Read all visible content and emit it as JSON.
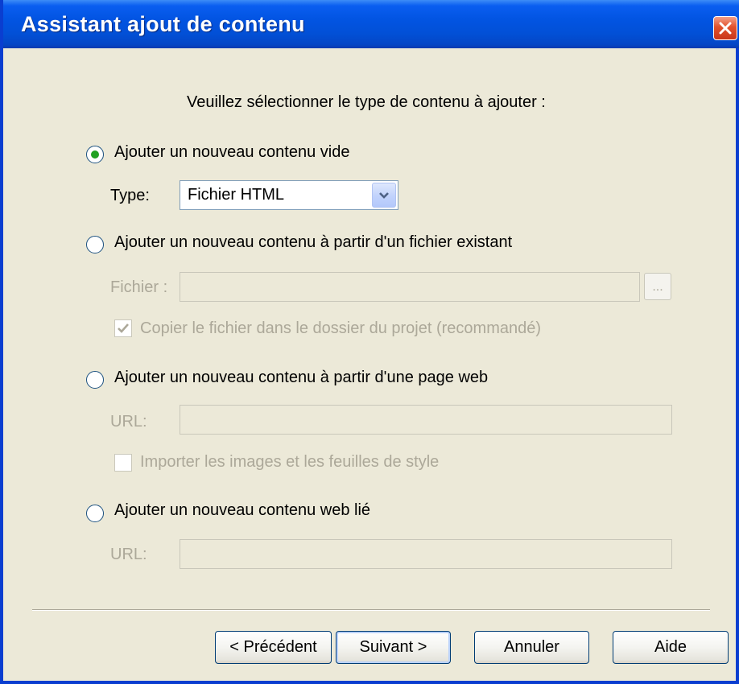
{
  "window": {
    "title": "Assistant ajout de contenu",
    "close_label": "close"
  },
  "instruction": "Veuillez sélectionner le type de contenu à ajouter :",
  "options": {
    "empty": {
      "label": "Ajouter un nouveau contenu vide",
      "selected": true,
      "type_label": "Type:",
      "type_value": "Fichier HTML"
    },
    "from_file": {
      "label": "Ajouter un nouveau contenu à partir d'un fichier existant",
      "selected": false,
      "file_label": "Fichier :",
      "file_value": "",
      "browse_label": "...",
      "copy_label": "Copier le fichier dans le dossier du projet (recommandé)",
      "copy_checked": true
    },
    "from_web": {
      "label": "Ajouter un nouveau contenu à partir d'une page web",
      "selected": false,
      "url_label": "URL:",
      "url_value": "",
      "import_label": "Importer les images et les feuilles de style",
      "import_checked": false
    },
    "linked_web": {
      "label": "Ajouter un nouveau contenu web lié",
      "selected": false,
      "url_label": "URL:",
      "url_value": ""
    }
  },
  "buttons": {
    "previous": "< Précédent",
    "next": "Suivant >",
    "cancel": "Annuler",
    "help": "Aide"
  },
  "colors": {
    "title_bar": "#0254e2",
    "dialog_bg": "#ece9d8",
    "radio_dot": "#21a121",
    "disabled_text": "#aca899",
    "close_button": "#e2512b"
  }
}
